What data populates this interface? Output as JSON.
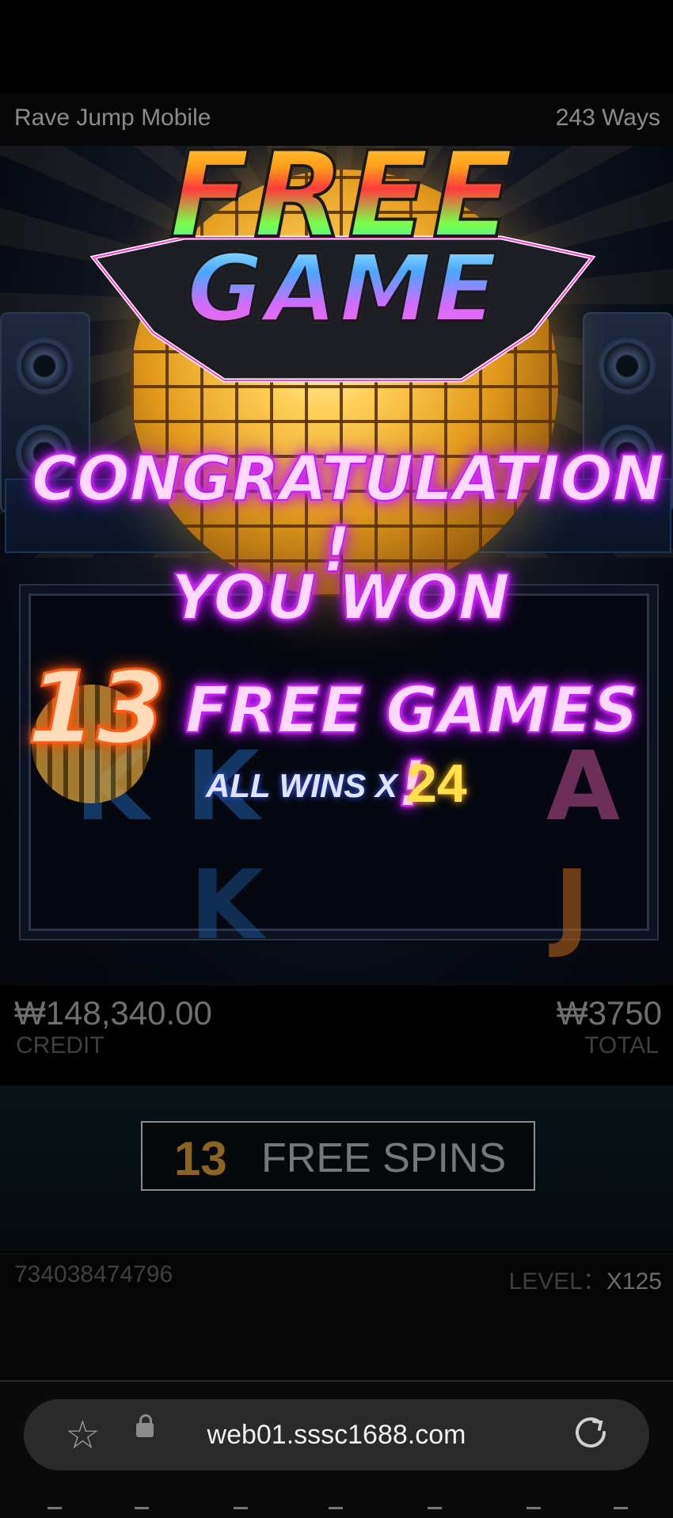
{
  "header": {
    "game_name": "Rave Jump Mobile",
    "ways": "243 Ways"
  },
  "banner": {
    "free": "FREE",
    "game": "GAME"
  },
  "popup": {
    "congrats": "CONGRATULATION !",
    "you_won": "YOU WON",
    "free_games_count": "13",
    "free_games": "FREE GAMES !",
    "all_wins": "ALL WINS X",
    "multiplier": "24"
  },
  "reel_symbols": [
    "K",
    "K",
    "A",
    "J",
    "K"
  ],
  "stats": {
    "credit_value": "₩148,340.00",
    "credit_label": "CREDIT",
    "total_value": "₩3750",
    "total_label": "TOTAL"
  },
  "spins": {
    "count": "13",
    "label": "FREE SPINS"
  },
  "footer": {
    "game_id": "734038474796",
    "level_label": "LEVEL：",
    "level_value": "X125"
  },
  "browser": {
    "url": "web01.sssc1688.com"
  }
}
